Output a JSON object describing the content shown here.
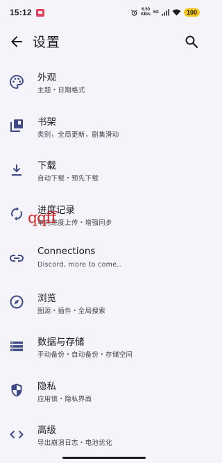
{
  "status_bar": {
    "time": "15:12",
    "speed_value": "6.50",
    "speed_unit": "KB/s",
    "network": "5G",
    "battery": "100"
  },
  "header": {
    "title": "设置"
  },
  "settings": {
    "items": [
      {
        "icon": "palette-icon",
        "title": "外观",
        "subtitle": "主题・日期格式"
      },
      {
        "icon": "library-icon",
        "title": "书架",
        "subtitle": "类别，全局更新，剧集滑动"
      },
      {
        "icon": "download-icon",
        "title": "下载",
        "subtitle": "自动下载・预先下载"
      },
      {
        "icon": "sync-icon",
        "title": "进度记录",
        "subtitle": "单向进度上传・增强同步"
      },
      {
        "icon": "link-icon",
        "title": "Connections",
        "subtitle": "Discord, more to come.."
      },
      {
        "icon": "compass-icon",
        "title": "浏览",
        "subtitle": "图源・插件・全局搜索"
      },
      {
        "icon": "storage-icon",
        "title": "数据与存储",
        "subtitle": "手动备份・自动备份・存储空间"
      },
      {
        "icon": "privacy-shield-icon",
        "title": "隐私",
        "subtitle": "应用锁・隐私界面"
      },
      {
        "icon": "code-icon",
        "title": "高级",
        "subtitle": "导出崩溃日志・电池优化"
      }
    ]
  },
  "overlay": {
    "watermark": "qqff"
  },
  "colors": {
    "background": "#f6f4fb",
    "icon": "#3d4a86",
    "battery": "#f2c51d"
  }
}
